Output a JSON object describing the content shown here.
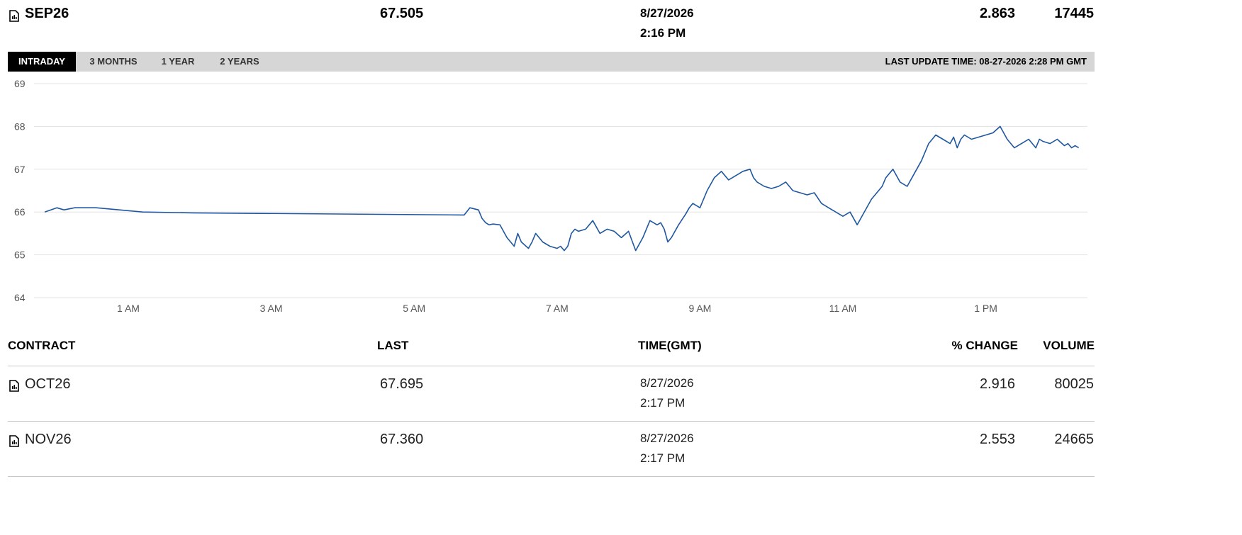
{
  "selected": {
    "contract": "SEP26",
    "last": "67.505",
    "date": "8/27/2026",
    "time": "2:16 PM",
    "pct_change": "2.863",
    "volume": "17445"
  },
  "tabs": [
    "INTRADAY",
    "3 MONTHS",
    "1 YEAR",
    "2 YEARS"
  ],
  "active_tab": "INTRADAY",
  "last_update": "LAST UPDATE TIME: 08-27-2026 2:28 PM GMT",
  "chart_data": {
    "type": "line",
    "ylim": [
      64,
      69
    ],
    "yticks": [
      "64",
      "65",
      "66",
      "67",
      "68",
      "69"
    ],
    "xticks": [
      "1 AM",
      "3 AM",
      "5 AM",
      "7 AM",
      "9 AM",
      "11 AM",
      "1 PM"
    ],
    "xlim_hours": [
      -0.17,
      14.55
    ],
    "grid": true,
    "line_color": "#1f57a0",
    "series": [
      {
        "x": [
          -0.17,
          0.0,
          0.1,
          0.25,
          0.55,
          1.2,
          1.9,
          5.7,
          5.78,
          5.9,
          5.95,
          6.0,
          6.05,
          6.1,
          6.2,
          6.3,
          6.4,
          6.45,
          6.5,
          6.6,
          6.65,
          6.7,
          6.8,
          6.9,
          7.0,
          7.05,
          7.1,
          7.15,
          7.2,
          7.25,
          7.3,
          7.4,
          7.5,
          7.6,
          7.7,
          7.8,
          7.9,
          8.0,
          8.1,
          8.2,
          8.3,
          8.4,
          8.45,
          8.5,
          8.55,
          8.6,
          8.7,
          8.8,
          8.85,
          8.9,
          9.0,
          9.1,
          9.2,
          9.3,
          9.4,
          9.5,
          9.6,
          9.7,
          9.75,
          9.8,
          9.9,
          10.0,
          10.1,
          10.2,
          10.3,
          10.4,
          10.5,
          10.6,
          10.7,
          10.8,
          10.9,
          11.0,
          11.1,
          11.2,
          11.3,
          11.4,
          11.5,
          11.55,
          11.6,
          11.7,
          11.8,
          11.9,
          12.0,
          12.1,
          12.2,
          12.3,
          12.4,
          12.5,
          12.55,
          12.6,
          12.65,
          12.7,
          12.8,
          12.9,
          13.0,
          13.1,
          13.2,
          13.3,
          13.4,
          13.5,
          13.6,
          13.7,
          13.75,
          13.8,
          13.9,
          14.0,
          14.1,
          14.15,
          14.2,
          14.25,
          14.3
        ],
        "y": [
          66.0,
          66.1,
          66.05,
          66.1,
          66.1,
          66.0,
          65.98,
          65.93,
          66.1,
          66.05,
          65.85,
          65.75,
          65.7,
          65.72,
          65.7,
          65.4,
          65.2,
          65.5,
          65.3,
          65.15,
          65.3,
          65.5,
          65.3,
          65.2,
          65.15,
          65.2,
          65.1,
          65.2,
          65.5,
          65.6,
          65.55,
          65.6,
          65.8,
          65.5,
          65.6,
          65.55,
          65.4,
          65.55,
          65.1,
          65.4,
          65.8,
          65.7,
          65.75,
          65.6,
          65.3,
          65.4,
          65.7,
          65.95,
          66.1,
          66.2,
          66.1,
          66.5,
          66.8,
          66.95,
          66.75,
          66.85,
          66.95,
          67.0,
          66.8,
          66.7,
          66.6,
          66.55,
          66.6,
          66.7,
          66.5,
          66.45,
          66.4,
          66.45,
          66.2,
          66.1,
          66.0,
          65.9,
          66.0,
          65.7,
          66.0,
          66.3,
          66.5,
          66.6,
          66.8,
          67.0,
          66.7,
          66.6,
          66.9,
          67.2,
          67.6,
          67.8,
          67.7,
          67.6,
          67.75,
          67.5,
          67.7,
          67.8,
          67.7,
          67.75,
          67.8,
          67.85,
          68.0,
          67.7,
          67.5,
          67.6,
          67.7,
          67.5,
          67.7,
          67.65,
          67.6,
          67.7,
          67.55,
          67.6,
          67.5,
          67.55,
          67.5
        ]
      }
    ]
  },
  "table": {
    "headers": {
      "contract": "CONTRACT",
      "last": "LAST",
      "time": "TIME(GMT)",
      "pct_change": "% CHANGE",
      "volume": "VOLUME"
    },
    "rows": [
      {
        "contract": "OCT26",
        "last": "67.695",
        "date": "8/27/2026",
        "time": "2:17 PM",
        "pct_change": "2.916",
        "volume": "80025"
      },
      {
        "contract": "NOV26",
        "last": "67.360",
        "date": "8/27/2026",
        "time": "2:17 PM",
        "pct_change": "2.553",
        "volume": "24665"
      }
    ]
  },
  "icon": "chart-document-icon"
}
